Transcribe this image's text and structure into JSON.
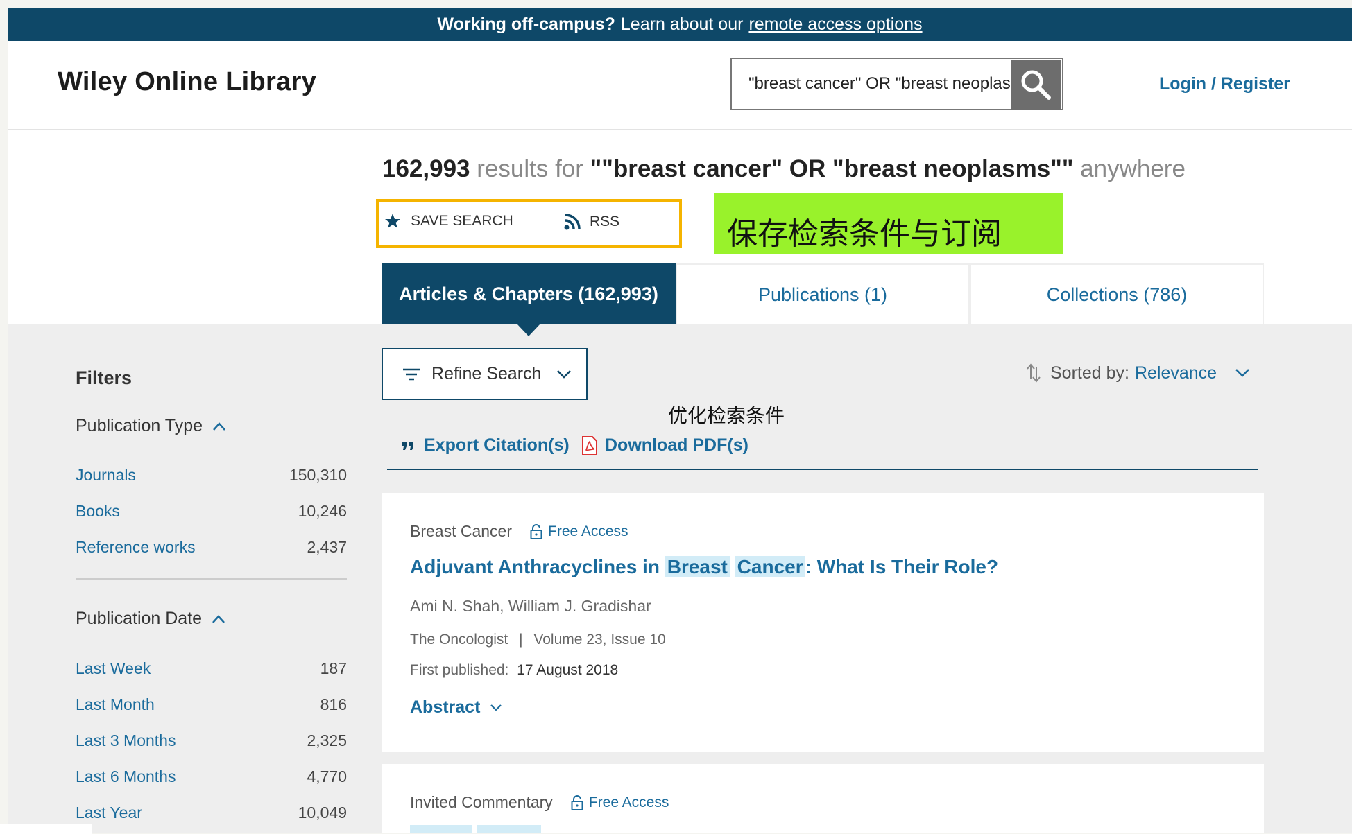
{
  "banner": {
    "bold": "Working off-campus?",
    "text": "Learn about our",
    "link": "remote access options"
  },
  "header": {
    "logo": "Wiley Online Library",
    "search_value": "\"breast cancer\" OR \"breast neoplasms\"",
    "login": "Login / Register"
  },
  "results": {
    "count": "162,993",
    "results_for": "results for",
    "query": "\"\"breast cancer\" OR \"breast neoplasms\"\"",
    "scope": "anywhere"
  },
  "actions": {
    "save_search": "SAVE SEARCH",
    "rss": "RSS"
  },
  "annotations": {
    "save_rss": "保存检索条件与订阅",
    "refine": "优化检索条件"
  },
  "tabs": [
    {
      "label": "Articles & Chapters (162,993)"
    },
    {
      "label": "Publications (1)"
    },
    {
      "label": "Collections (786)"
    }
  ],
  "filters": {
    "title": "Filters",
    "publication_type": {
      "heading": "Publication Type",
      "items": [
        {
          "label": "Journals",
          "count": "150,310"
        },
        {
          "label": "Books",
          "count": "10,246"
        },
        {
          "label": "Reference works",
          "count": "2,437"
        }
      ]
    },
    "publication_date": {
      "heading": "Publication Date",
      "items": [
        {
          "label": "Last Week",
          "count": "187"
        },
        {
          "label": "Last Month",
          "count": "816"
        },
        {
          "label": "Last 3 Months",
          "count": "2,325"
        },
        {
          "label": "Last 6 Months",
          "count": "4,770"
        },
        {
          "label": "Last Year",
          "count": "10,049"
        }
      ]
    }
  },
  "toolbar": {
    "refine": "Refine Search",
    "sorted_label": "Sorted by:",
    "sorted_value": "Relevance",
    "export": "Export Citation(s)",
    "download": "Download PDF(s)"
  },
  "results_list": [
    {
      "type": "Breast Cancer",
      "access": "Free Access",
      "title_parts": [
        "Adjuvant Anthracyclines in",
        "Breast",
        "Cancer",
        ": What Is Their Role?"
      ],
      "authors": "Ami N. Shah, William J. Gradishar",
      "journal": "The Oncologist",
      "volume": "Volume 23, Issue 10",
      "first_published_label": "First published:",
      "first_published_date": "17 August 2018",
      "abstract": "Abstract"
    },
    {
      "type": "Invited Commentary",
      "access": "Free Access"
    }
  ],
  "colors": {
    "brand_dark": "#0e4868",
    "link": "#1a6b9c",
    "highlight_box": "#f5b400",
    "annotation_green": "#99f22b",
    "term_highlight": "#d2ecf7"
  }
}
